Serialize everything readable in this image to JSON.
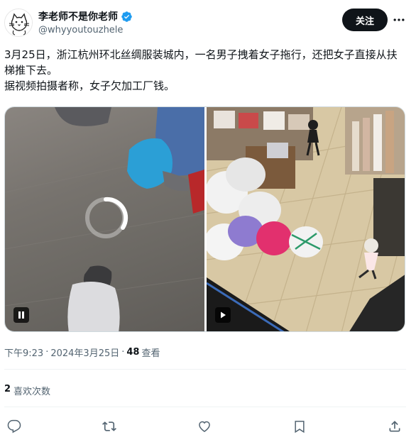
{
  "author": {
    "display_name": "李老师不是你老师",
    "handle": "@whyyoutouzhele",
    "verified_icon": "verified-badge-icon",
    "avatar_icon": "cat-sketch-avatar"
  },
  "header": {
    "follow_label": "关注",
    "more_icon": "more-horizontal-icon"
  },
  "tweet": {
    "text_lines": [
      "3月25日，浙江杭州环北丝绸服装城内，一名男子拽着女子拖行，还把女子直接从扶梯推下去。",
      "据视频拍摄者称，女子欠加工厂钱。"
    ]
  },
  "media": {
    "left_video_control": "pause-icon",
    "right_video_control": "play-icon",
    "loading_icon": "loading-spinner-icon"
  },
  "meta": {
    "time": "下午9:23",
    "separator": "·",
    "date": "2024年3月25日",
    "separator2": "·",
    "views_count": "48",
    "views_label": "查看"
  },
  "stats": {
    "likes_count": "2",
    "likes_label": "喜欢次数"
  },
  "actions": [
    {
      "name": "reply",
      "icon": "reply-icon"
    },
    {
      "name": "repost",
      "icon": "repost-icon"
    },
    {
      "name": "like",
      "icon": "heart-icon"
    },
    {
      "name": "bookmark",
      "icon": "bookmark-icon"
    },
    {
      "name": "share",
      "icon": "share-icon"
    }
  ],
  "colors": {
    "text_primary": "#0f1419",
    "text_secondary": "#536471",
    "verified_blue": "#1d9bf0",
    "button_dark": "#0f1419"
  }
}
